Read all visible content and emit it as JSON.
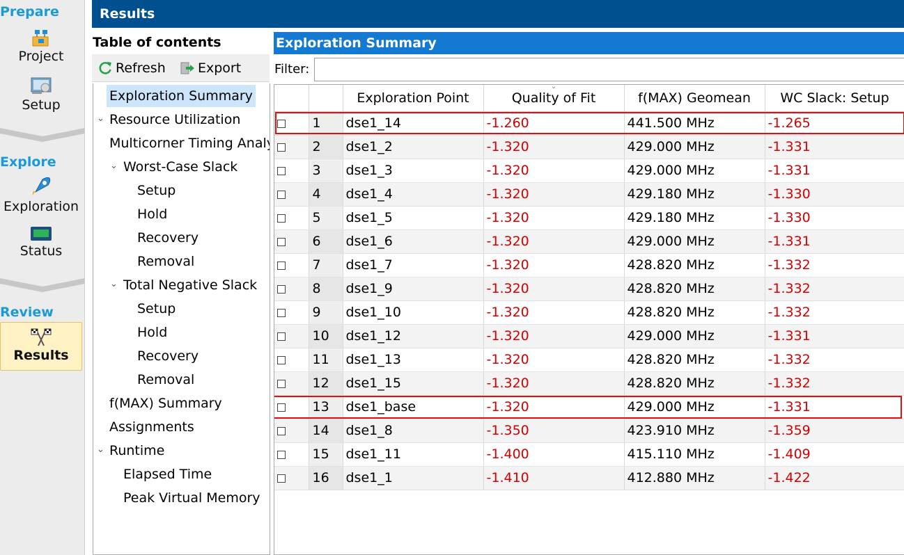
{
  "rail": {
    "prepare": {
      "label": "Prepare",
      "items": [
        {
          "label": "Project",
          "icon": "project-icon"
        },
        {
          "label": "Setup",
          "icon": "setup-icon"
        }
      ]
    },
    "explore": {
      "label": "Explore",
      "items": [
        {
          "label": "Exploration",
          "icon": "rocket-icon"
        },
        {
          "label": "Status",
          "icon": "monitor-icon"
        }
      ]
    },
    "review": {
      "label": "Review",
      "items": [
        {
          "label": "Results",
          "icon": "checkered-flags-icon",
          "active": true
        }
      ]
    }
  },
  "title": "Results",
  "toc": {
    "title": "Table of contents",
    "refresh_label": "Refresh",
    "export_label": "Export",
    "items": [
      {
        "label": "Exploration Summary",
        "selected": true
      },
      {
        "label": "Resource Utilization"
      },
      {
        "label": "Multicorner Timing Analysis",
        "expandable": true,
        "expanded": true
      },
      {
        "label": "Worst-Case Slack",
        "expandable": true,
        "expanded": true
      },
      {
        "label": "Setup"
      },
      {
        "label": "Hold"
      },
      {
        "label": "Recovery"
      },
      {
        "label": "Removal"
      },
      {
        "label": "Total Negative Slack",
        "expandable": true,
        "expanded": true
      },
      {
        "label": "Setup"
      },
      {
        "label": "Hold"
      },
      {
        "label": "Recovery"
      },
      {
        "label": "Removal"
      },
      {
        "label": "f(MAX) Summary"
      },
      {
        "label": "Assignments"
      },
      {
        "label": "Runtime",
        "expandable": true,
        "expanded": true
      },
      {
        "label": "Elapsed Time"
      },
      {
        "label": "Peak Virtual Memory"
      }
    ]
  },
  "panel": {
    "title": "Exploration Summary",
    "filter_label": "Filter:",
    "filter_value": "",
    "columns": [
      "",
      "",
      "Exploration Point",
      "Quality of Fit",
      "f(MAX) Geomean",
      "WC Slack: Setup"
    ],
    "rows": [
      {
        "n": "1",
        "point": "dse1_14",
        "qof": "-1.260",
        "fmax": "441.500 MHz",
        "slack": "-1.265",
        "highlight": true
      },
      {
        "n": "2",
        "point": "dse1_2",
        "qof": "-1.320",
        "fmax": "429.000 MHz",
        "slack": "-1.331"
      },
      {
        "n": "3",
        "point": "dse1_3",
        "qof": "-1.320",
        "fmax": "429.000 MHz",
        "slack": "-1.331"
      },
      {
        "n": "4",
        "point": "dse1_4",
        "qof": "-1.320",
        "fmax": "429.180 MHz",
        "slack": "-1.330"
      },
      {
        "n": "5",
        "point": "dse1_5",
        "qof": "-1.320",
        "fmax": "429.180 MHz",
        "slack": "-1.330"
      },
      {
        "n": "6",
        "point": "dse1_6",
        "qof": "-1.320",
        "fmax": "429.000 MHz",
        "slack": "-1.331"
      },
      {
        "n": "7",
        "point": "dse1_7",
        "qof": "-1.320",
        "fmax": "428.820 MHz",
        "slack": "-1.332"
      },
      {
        "n": "8",
        "point": "dse1_9",
        "qof": "-1.320",
        "fmax": "428.820 MHz",
        "slack": "-1.332"
      },
      {
        "n": "9",
        "point": "dse1_10",
        "qof": "-1.320",
        "fmax": "428.820 MHz",
        "slack": "-1.332"
      },
      {
        "n": "10",
        "point": "dse1_12",
        "qof": "-1.320",
        "fmax": "429.000 MHz",
        "slack": "-1.331"
      },
      {
        "n": "11",
        "point": "dse1_13",
        "qof": "-1.320",
        "fmax": "428.820 MHz",
        "slack": "-1.332"
      },
      {
        "n": "12",
        "point": "dse1_15",
        "qof": "-1.320",
        "fmax": "428.820 MHz",
        "slack": "-1.332"
      },
      {
        "n": "13",
        "point": "dse1_base",
        "qof": "-1.320",
        "fmax": "429.000 MHz",
        "slack": "-1.331",
        "highlight": true
      },
      {
        "n": "14",
        "point": "dse1_8",
        "qof": "-1.350",
        "fmax": "423.910 MHz",
        "slack": "-1.359"
      },
      {
        "n": "15",
        "point": "dse1_11",
        "qof": "-1.400",
        "fmax": "415.110 MHz",
        "slack": "-1.409"
      },
      {
        "n": "16",
        "point": "dse1_1",
        "qof": "-1.410",
        "fmax": "412.880 MHz",
        "slack": "-1.422"
      }
    ]
  },
  "colors": {
    "title_bar": "#00508f",
    "panel_header": "#1479d0",
    "section_heading": "#1a9ad6",
    "negative_value": "#d40000",
    "highlight_box": "#e01010",
    "selection": "#cce5fb"
  }
}
